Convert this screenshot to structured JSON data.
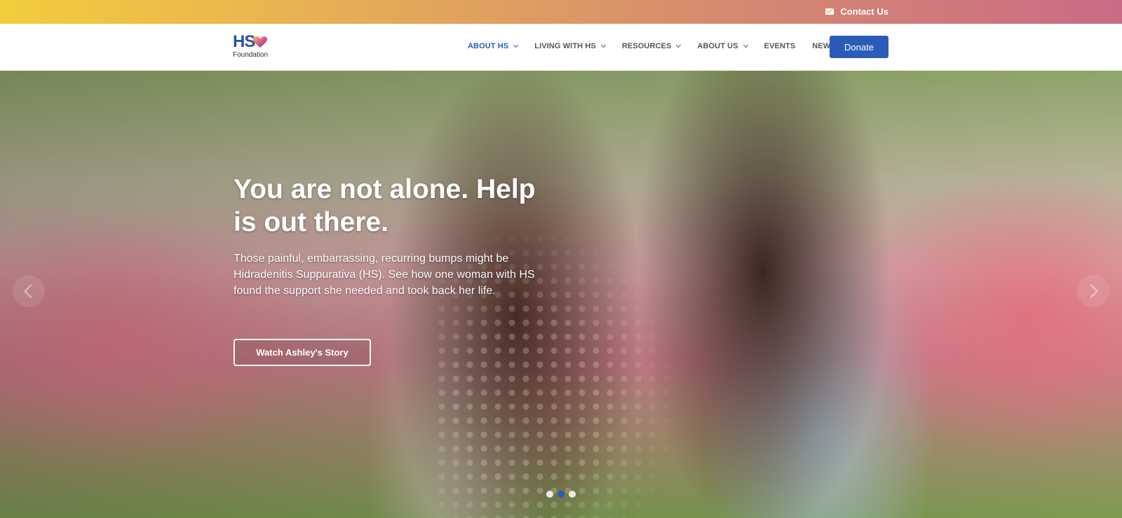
{
  "topbar": {
    "contact_label": "Contact Us",
    "contact_icon": "mail-icon"
  },
  "header": {
    "logo": {
      "text": "HS",
      "subtext": "Foundation"
    },
    "nav": [
      {
        "label": "ABOUT HS",
        "has_dropdown": true,
        "active": true
      },
      {
        "label": "LIVING WITH HS",
        "has_dropdown": true,
        "active": false
      },
      {
        "label": "RESOURCES",
        "has_dropdown": true,
        "active": false
      },
      {
        "label": "ABOUT US",
        "has_dropdown": true,
        "active": false
      },
      {
        "label": "EVENTS",
        "has_dropdown": false,
        "active": false
      },
      {
        "label": "NEWS",
        "has_dropdown": false,
        "active": false
      }
    ],
    "donate_label": "Donate"
  },
  "hero": {
    "title": "You are not alone. Help is out there.",
    "text": "Those painful, embarrassing, recurring bumps might be Hidradenitis Suppurativa (HS). See how one woman with HS found the support she needed and took back her life.",
    "button_label": "Watch Ashley's Story",
    "slides": 3,
    "active_slide": 2
  },
  "colors": {
    "brand_blue": "#2a5bb8",
    "topbar_gradient_start": "#f2cd3c",
    "topbar_gradient_end": "#c96b86"
  }
}
